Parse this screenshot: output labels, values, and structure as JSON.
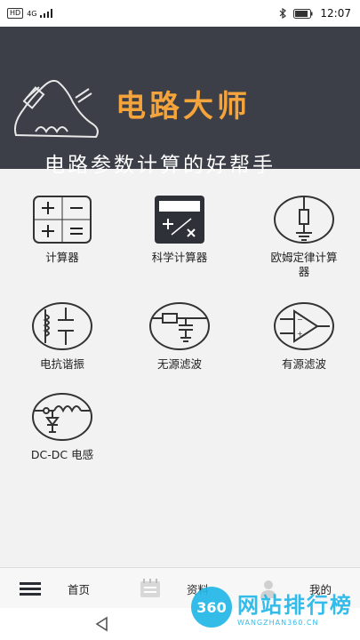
{
  "status_bar": {
    "left_badge": "HD",
    "net_type": "4G",
    "time": "12:07"
  },
  "banner": {
    "title": "电路大师",
    "tagline": "电路参数计算的好帮手",
    "colors": {
      "background": "#3d3f48",
      "title": "#f4a43a"
    }
  },
  "tools": [
    {
      "label": "计算器",
      "icon": "basic-calculator-icon"
    },
    {
      "label": "科学计算器",
      "icon": "scientific-calculator-icon"
    },
    {
      "label": "欧姆定律计算器",
      "icon": "ohms-law-icon"
    },
    {
      "label": "电抗谐振",
      "icon": "reactance-resonance-icon"
    },
    {
      "label": "无源滤波",
      "icon": "passive-filter-icon"
    },
    {
      "label": "有源滤波",
      "icon": "active-filter-icon"
    },
    {
      "label": "DC-DC 电感",
      "icon": "dcdc-inductor-icon"
    }
  ],
  "bottom_nav": {
    "home": "首页",
    "data": "资料",
    "mine": "我的"
  },
  "watermark": {
    "badge": "360",
    "main": "网站排行榜",
    "sub": "WANGZHAN360.CN"
  }
}
